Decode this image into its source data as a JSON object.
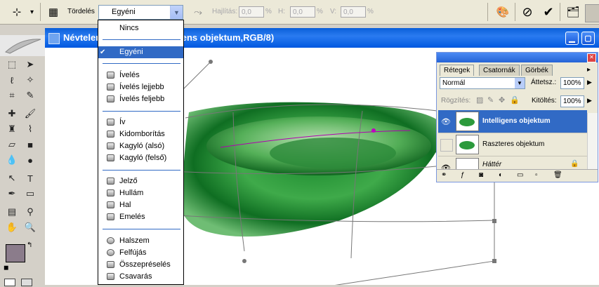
{
  "options": {
    "warp_label": "Tördelés",
    "warp_value": "Egyéni",
    "bend_label": "Hajlítás:",
    "bend_value": "0,0",
    "h_label": "H:",
    "h_value": "0,0",
    "v_label": "V:",
    "v_value": "0,0",
    "percent": "%"
  },
  "document": {
    "title": "Névtelen-1 @ 100% (Intelligens objektum,RGB/8)"
  },
  "warp_menu": {
    "items": [
      {
        "label": "Nincs"
      },
      {
        "label": "Egyéni"
      },
      {
        "label": "Ívelés"
      },
      {
        "label": "Ívelés lejjebb"
      },
      {
        "label": "Ívelés feljebb"
      },
      {
        "label": "Ív"
      },
      {
        "label": "Kidomborítás"
      },
      {
        "label": "Kagyló (alsó)"
      },
      {
        "label": "Kagyló (felső)"
      },
      {
        "label": "Jelző"
      },
      {
        "label": "Hullám"
      },
      {
        "label": "Hal"
      },
      {
        "label": "Emelés"
      },
      {
        "label": "Halszem"
      },
      {
        "label": "Felfújás"
      },
      {
        "label": "Összepréselés"
      },
      {
        "label": "Csavarás"
      }
    ]
  },
  "layers": {
    "tabs": [
      "Rétegek",
      "Csatornák",
      "Görbék"
    ],
    "blend_mode": "Normál",
    "opacity_label": "Áttetsz.:",
    "opacity_value": "100%",
    "lock_label": "Rögzítés:",
    "fill_label": "Kitöltés:",
    "fill_value": "100%",
    "rows": [
      {
        "name": "Intelligens objektum"
      },
      {
        "name": "Raszteres objektum"
      },
      {
        "name": "Háttér"
      }
    ]
  },
  "colors": {
    "accent": "#316ac5",
    "title_bar": "#0a5fd9",
    "foreground": "#8b7c8b"
  }
}
